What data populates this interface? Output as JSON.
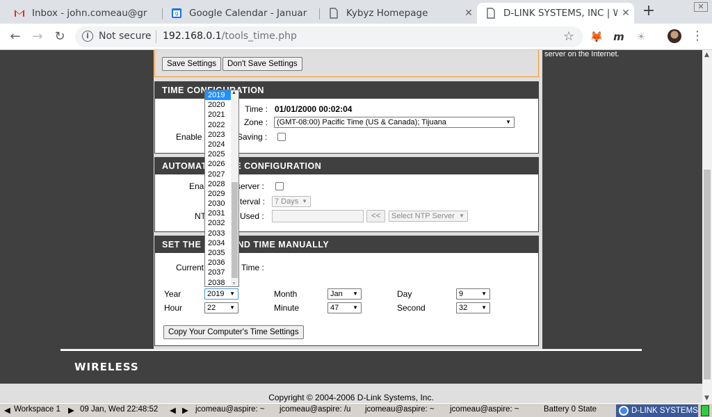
{
  "browser": {
    "tabs": [
      {
        "title": "Inbox - john.comeau@gr",
        "icon": "gmail-icon"
      },
      {
        "title": "Google Calendar - Januar",
        "icon": "calendar-icon"
      },
      {
        "title": "Kybyz Homepage",
        "icon": "document-icon"
      },
      {
        "title": "D-LINK SYSTEMS, INC | W",
        "icon": "document-icon"
      }
    ],
    "security": "Not secure",
    "url_host": "192.168.0.1",
    "url_path": "/tools_time.php",
    "calendar_badge": "9"
  },
  "save_bar": {
    "save_label": "Save Settings",
    "dont_save_label": "Don't Save Settings"
  },
  "right_note": "server on the Internet.",
  "time_config": {
    "header": "TIME CONFIGURATION",
    "current_time_label": "Time :",
    "current_time_value": "01/01/2000 00:02:04",
    "zone_label": "Zone :",
    "zone_value": "(GMT-08:00) Pacific Time (US & Canada); Tijuana",
    "dst_label_left": "Enable",
    "dst_label_right": "Saving :"
  },
  "auto_config": {
    "header": "AUTOMATIC TIME CONFIGURATION",
    "enable_label_left": "Enab",
    "enable_label_right": "server :",
    "interval_label": "terval :",
    "interval_value": "7 Days",
    "ntp_label_left": "NT",
    "ntp_label_right": "Used :",
    "arrow_button": "<<",
    "ntp_select": "Select NTP Server"
  },
  "manual": {
    "header": "SET THE DATE AND TIME MANUALLY",
    "current_label_left": "Current",
    "current_label_right": "Time :",
    "year_label": "Year",
    "year_value": "2019",
    "month_label": "Month",
    "month_value": "Jan",
    "day_label": "Day",
    "day_value": "9",
    "hour_label": "Hour",
    "hour_value": "22",
    "minute_label": "Minute",
    "minute_value": "47",
    "second_label": "Second",
    "second_value": "32",
    "copy_button": "Copy Your Computer's Time Settings"
  },
  "year_options": [
    "2019",
    "2020",
    "2021",
    "2022",
    "2023",
    "2024",
    "2025",
    "2026",
    "2027",
    "2028",
    "2029",
    "2030",
    "2031",
    "2032",
    "2033",
    "2034",
    "2035",
    "2036",
    "2037",
    "2038"
  ],
  "year_highlight": "2019",
  "footer": {
    "logo": "WIRELESS",
    "copyright": "Copyright © 2004-2006 D-Link Systems, Inc."
  },
  "taskbar": {
    "workspace": "Workspace 1",
    "datetime": "09 Jan, Wed 22:48:52",
    "items": [
      "jcomeau@aspire: ~",
      "jcomeau@aspire: /u",
      "jcomeau@aspire: ~",
      "jcomeau@aspire: ~"
    ],
    "battery": "Battery 0 State",
    "active": "D-LINK SYSTEMS"
  },
  "colors": {
    "dark_bg": "#404040",
    "accent_orange": "#f7931e",
    "highlight": "#1e90ff"
  }
}
